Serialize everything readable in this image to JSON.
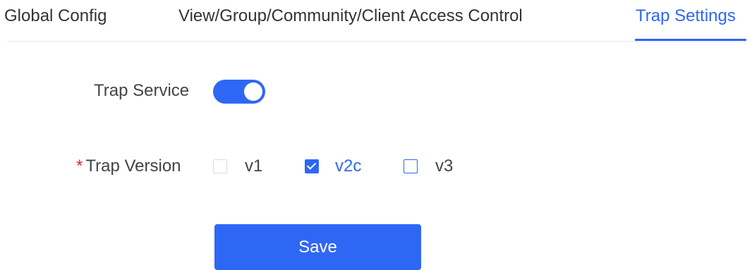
{
  "tabs": [
    {
      "label": "Global Config",
      "active": false
    },
    {
      "label": "View/Group/Community/Client Access Control",
      "active": false
    },
    {
      "label": "Trap Settings",
      "active": true
    }
  ],
  "form": {
    "trap_service": {
      "label": "Trap Service",
      "enabled": true
    },
    "trap_version": {
      "required_marker": "*",
      "label": "Trap Version",
      "options": [
        {
          "label": "v1",
          "checked": false,
          "disabled": true
        },
        {
          "label": "v2c",
          "checked": true,
          "disabled": false
        },
        {
          "label": "v3",
          "checked": false,
          "disabled": false
        }
      ]
    },
    "save_label": "Save"
  },
  "colors": {
    "accent": "#2f67f5",
    "required": "#f5222d",
    "text": "#333333",
    "divider": "#e8e8e8"
  }
}
